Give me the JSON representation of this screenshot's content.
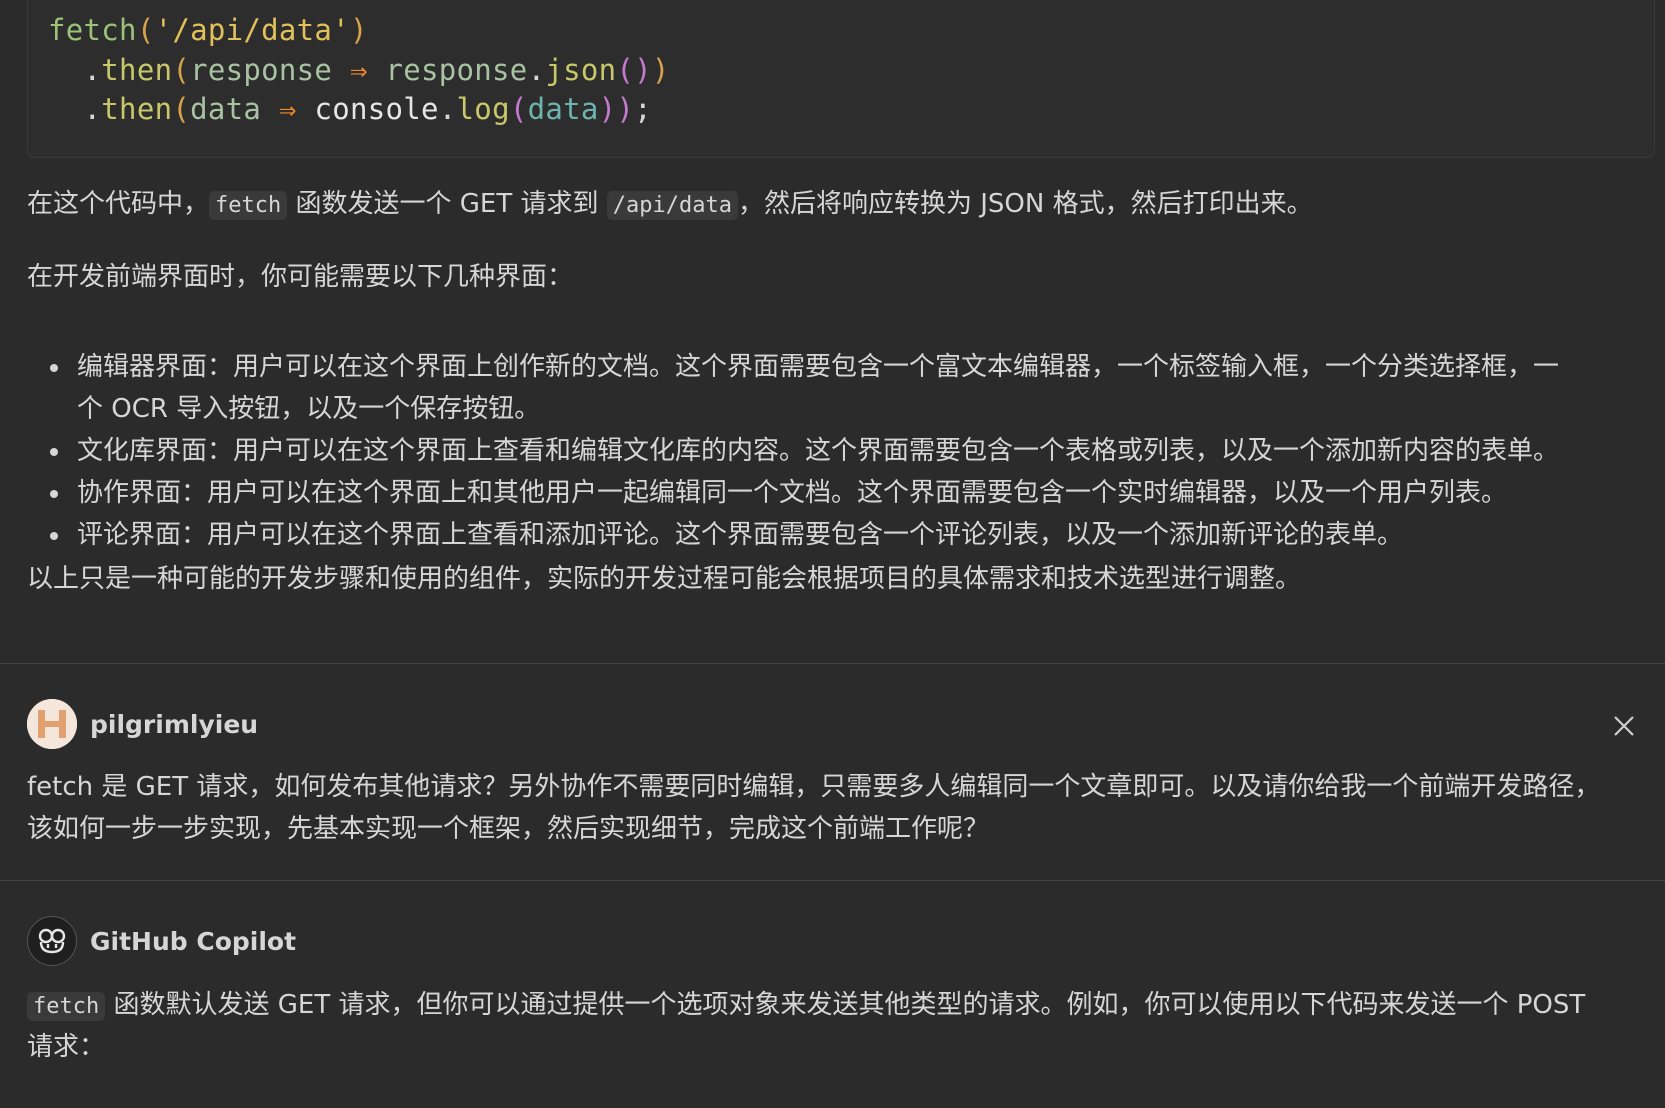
{
  "code": {
    "line1": {
      "a": "fetch",
      "b": "(",
      "c": "'/api/data'",
      "d": ")"
    },
    "line2": {
      "a": ".",
      "b": "then",
      "c": "(",
      "d": "response",
      "e": "⇒",
      "f": "response",
      "g": ".",
      "h": "json",
      "i": "()",
      "j": ")"
    },
    "line3": {
      "a": ".",
      "b": "then",
      "c": "(",
      "d": "data",
      "e": "⇒",
      "f": "console",
      "g": ".",
      "h": "log",
      "i": "(",
      "j": "data",
      "k": "))",
      "l": ";"
    }
  },
  "para1": {
    "pre": "在这个代码中，",
    "code1": "fetch",
    "mid": "函数发送一个 GET 请求到",
    "code2": "/api/data",
    "post": "，然后将响应转换为 JSON 格式，然后打印出来。"
  },
  "para2": "在开发前端界面时，你可能需要以下几种界面：",
  "bullets": [
    {
      "line1": "编辑器界面：用户可以在这个界面上创作新的文档。这个界面需要包含一个富文本编辑器，一个标签输入框，一个分类选择框，一",
      "line2": "个 OCR 导入按钮，以及一个保存按钮。"
    },
    {
      "line1": "文化库界面：用户可以在这个界面上查看和编辑文化库的内容。这个界面需要包含一个表格或列表，以及一个添加新内容的表单。"
    },
    {
      "line1": "协作界面：用户可以在这个界面上和其他用户一起编辑同一个文档。这个界面需要包含一个实时编辑器，以及一个用户列表。"
    },
    {
      "line1": "评论界面：用户可以在这个界面上查看和添加评论。这个界面需要包含一个评论列表，以及一个添加新评论的表单。"
    }
  ],
  "para3": "以上只是一种可能的开发步骤和使用的组件，实际的开发过程可能会根据项目的具体需求和技术选型进行调整。",
  "user_message": {
    "username": "pilgrimlyieu",
    "line1": "fetch 是 GET 请求，如何发布其他请求？另外协作不需要同时编辑，只需要多人编辑同一个文章即可。以及请你给我一个前端开发路径，",
    "line2": "该如何一步一步实现，先基本实现一个框架，然后实现细节，完成这个前端工作呢？"
  },
  "bot_message": {
    "name": "GitHub Copilot",
    "code": "fetch",
    "line1_rest": "函数默认发送 GET 请求，但你可以通过提供一个选项对象来发送其他类型的请求。例如，你可以使用以下代码来发送一个 POST",
    "line2": "请求："
  },
  "icons": {
    "user_avatar": "user-avatar-icon",
    "copilot_avatar": "copilot-icon",
    "close": "close-icon"
  }
}
